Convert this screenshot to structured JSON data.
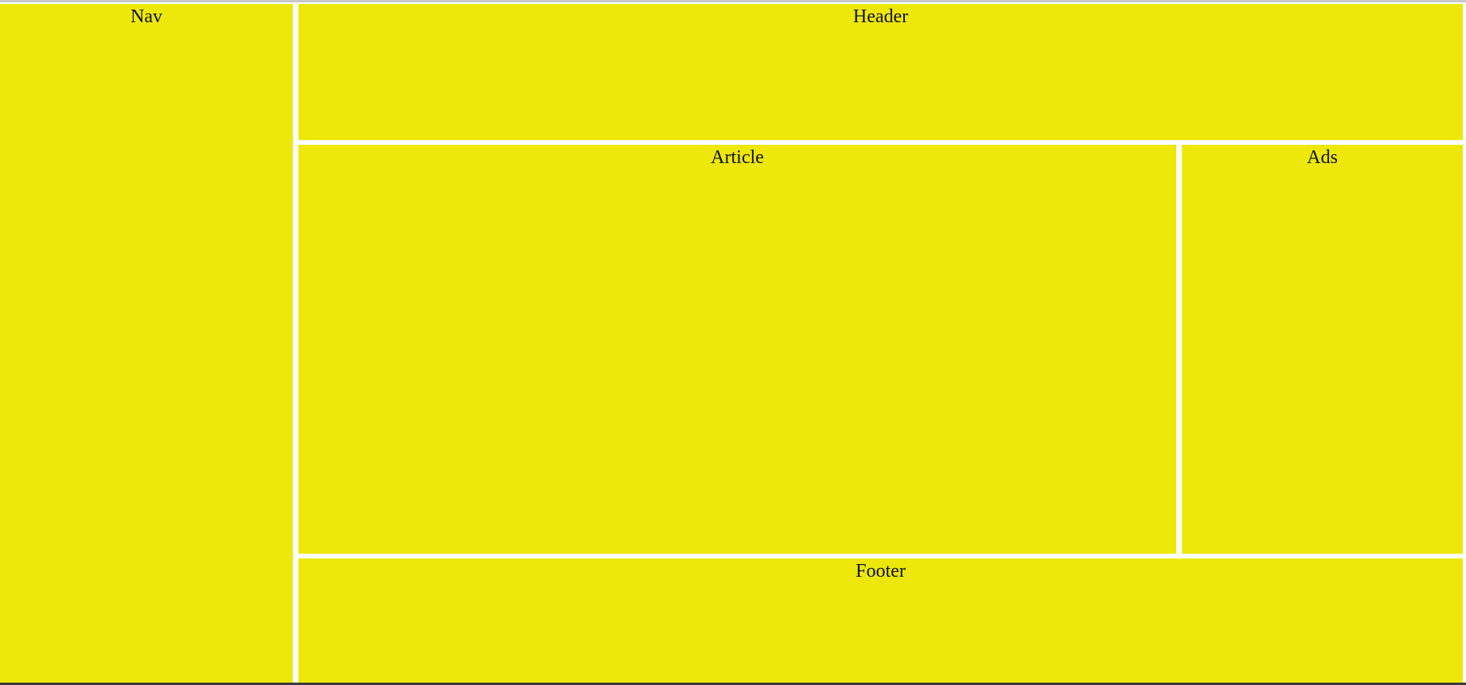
{
  "colors": {
    "panel_background": "#ede80a",
    "page_background": "#ffffff",
    "text": "#111111"
  },
  "layout_panels": {
    "nav": "Nav",
    "header": "Header",
    "article": "Article",
    "ads": "Ads",
    "footer": "Footer"
  }
}
